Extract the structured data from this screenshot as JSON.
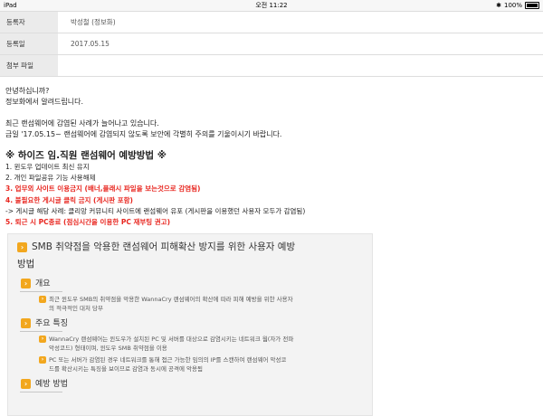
{
  "statusbar": {
    "device": "iPad",
    "time": "오전 11:22",
    "battery_text": "100%",
    "battery_level": 1.0
  },
  "meta": [
    {
      "label": "등록자",
      "value": "박성철 (정보화)"
    },
    {
      "label": "등록일",
      "value": "2017.05.15"
    },
    {
      "label": "첨부 파일",
      "value": ""
    }
  ],
  "body": {
    "greeting1": "안녕하십니까?",
    "greeting2": "정보화에서 알려드립니다.",
    "para1": "최근 랜섬웨어에 감염된 사례가 늘어나고 있습니다.",
    "para2": "금일 '17.05.15~ 랜섬웨어에 감염되지 않도록 보안에 각별히 주의를 기울이시기 바랍니다.",
    "heading": "※ 하이즈 임.직원 랜섬웨어 예방방법 ※",
    "list": [
      {
        "text": "1. 윈도우 업데이트 최신 유지",
        "red": false
      },
      {
        "text": "2. 개인 파일공유 기능 사용해제",
        "red": false
      },
      {
        "text": "3. 업무외 사이트 이용금지 (배너,플래시 파일을 보는것으로 감염됨)",
        "red": true
      },
      {
        "text": "4. 불필요한 게시글 클릭 금지 (게시판 포함)",
        "red": true
      },
      {
        "text": "-> 게시글 해당 사례: 클리앙 커뮤니티 사이트에 랜섬웨어 유포 (게시판을 이용했던 사용자 모두가 감염됨)",
        "red": false
      },
      {
        "text": "5. 퇴근 시 PC종료 (점심시간을 이용한 PC 재부팅 권고)",
        "red": true
      }
    ]
  },
  "box": {
    "title_line1": "SMB 취약점을 악용한 랜섬웨어 피해확산 방지를 위한 사용자 예방",
    "title_line2": "방법",
    "sections": [
      {
        "title": "개요",
        "items": [
          {
            "line1": "최근 윈도우 SMB의 취약점을 악용한 WannaCry 랜섬웨어의 확산에 따라 피해 예방을 위한 사용자",
            "line2": "의 적극적인 대처 당부"
          }
        ]
      },
      {
        "title": "주요 특징",
        "items": [
          {
            "line1": "WannaCry 랜섬웨어는 윈도우가 설치된 PC 및 서버를 대상으로 감염시키는 네트워크 웜(자가 전파",
            "line2": "악성코드) 형태이며, 윈도우 SMB 취약점을 이용"
          },
          {
            "line1": "PC 또는 서버가 감염된 경우 네트워크를 통해 접근 가능한 임의의 IP를 스캔하여 랜섬웨어 악성코",
            "line2": "드를 확산시키는 특징을 보이므로 감염과 동시에 공격에 악용됨"
          }
        ]
      },
      {
        "title": "예방 방법",
        "items": []
      }
    ]
  }
}
